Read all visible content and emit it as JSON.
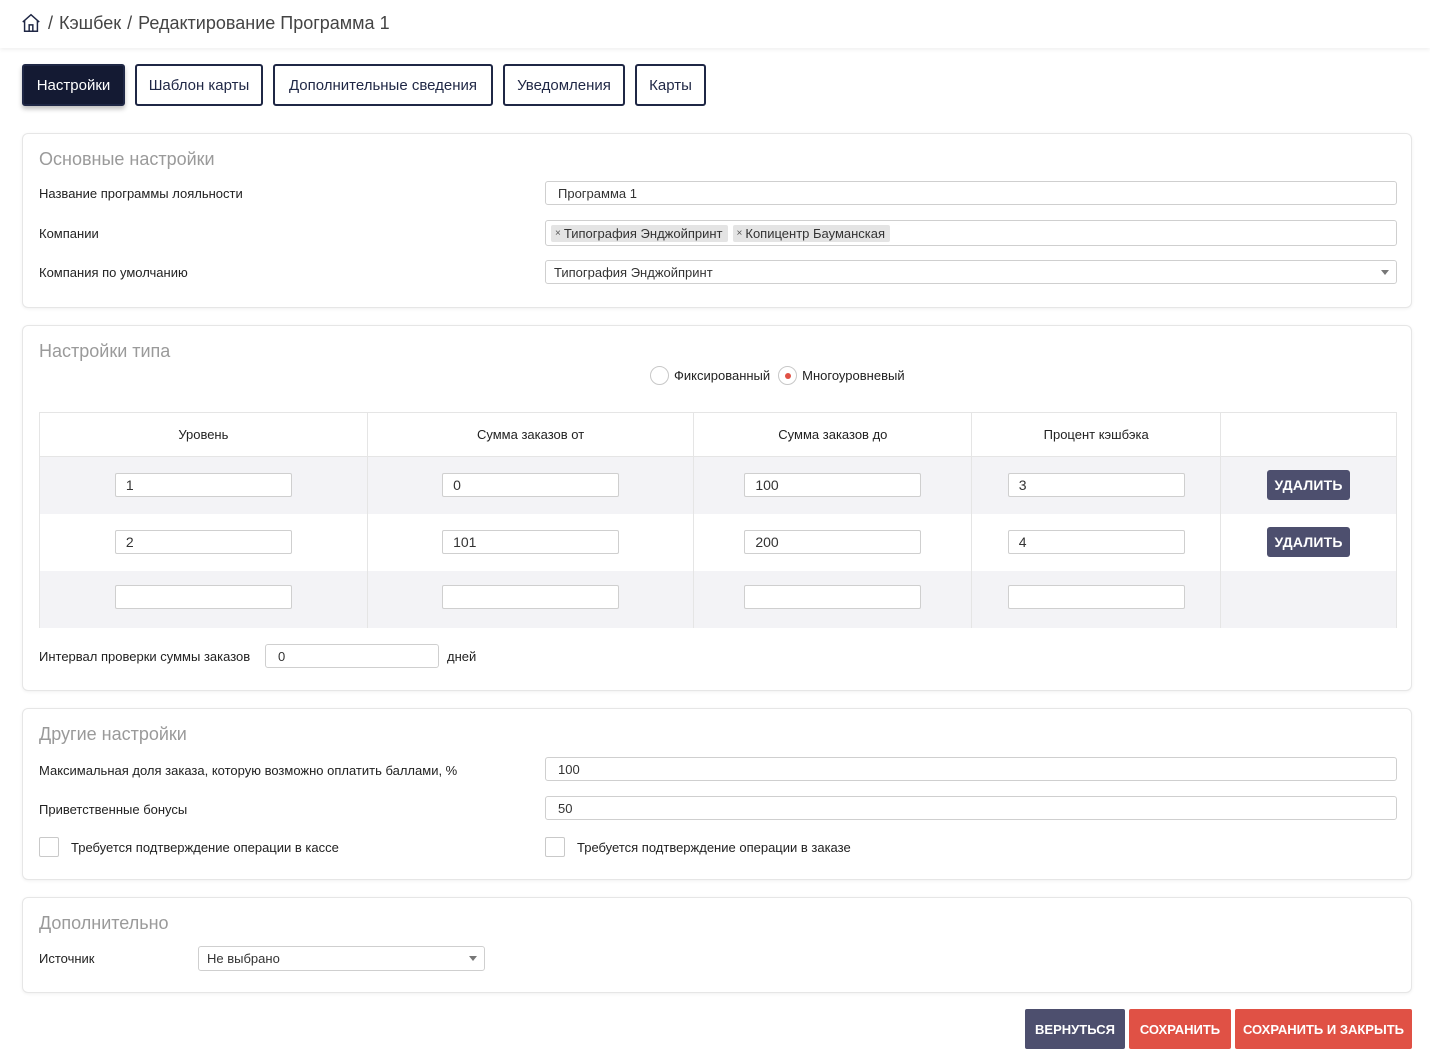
{
  "breadcrumb": {
    "sep1": "/",
    "section": "Кэшбек",
    "sep2": "/",
    "page": "Редактирование Программа 1"
  },
  "tabs": [
    "Настройки",
    "Шаблон карты",
    "Дополнительные сведения",
    "Уведомления",
    "Карты"
  ],
  "main_settings": {
    "title": "Основные настройки",
    "name_label": "Название программы лояльности",
    "name_value": "Программа  1",
    "companies_label": "Компании",
    "companies": [
      "Типография Энджойпринт",
      "Копицентр Бауманская"
    ],
    "tag_remove": "×",
    "default_company_label": "Компания по умолчанию",
    "default_company_value": "Типография Энджойпринт"
  },
  "type_settings": {
    "title": "Настройки типа",
    "radio_fixed": "Фиксированный",
    "radio_multi": "Многоуровневый",
    "selected": "Многоуровневый",
    "columns": [
      "Уровень",
      "Сумма заказов от",
      "Сумма заказов до",
      "Процент кэшбэка",
      ""
    ],
    "rows": [
      {
        "level": "1",
        "from": "0",
        "to": "100",
        "percent": "3",
        "action": "УДАЛИТЬ"
      },
      {
        "level": "2",
        "from": "101",
        "to": "200",
        "percent": "4",
        "action": "УДАЛИТЬ"
      },
      {
        "level": "",
        "from": "",
        "to": "",
        "percent": "",
        "action": ""
      }
    ],
    "interval_label": "Интервал проверки суммы заказов",
    "interval_value": "0",
    "interval_unit": "дней"
  },
  "other_settings": {
    "title": "Другие настройки",
    "max_share_label": "Максимальная доля заказа, которую возможно оплатить баллами, %",
    "max_share_value": "100",
    "welcome_label": "Приветственные бонусы",
    "welcome_value": "50",
    "confirm_cashbox_label": "Требуется подтверждение операции в кассе",
    "confirm_order_label": "Требуется подтверждение операции в заказе"
  },
  "additional": {
    "title": "Дополнительно",
    "source_label": "Источник",
    "source_value": "Не выбрано"
  },
  "actions": {
    "back": "ВЕРНУТЬСЯ",
    "save": "СОХРАНИТЬ",
    "save_close": "СОХРАНИТЬ И ЗАКРЫТЬ"
  },
  "colors": {
    "primary_dark": "#141a33",
    "button_gray": "#4d4f6e",
    "accent_red": "#e05145"
  },
  "icons": {
    "home": "home-icon",
    "dropdown": "chevron-down-icon",
    "tag_remove": "close-icon"
  }
}
